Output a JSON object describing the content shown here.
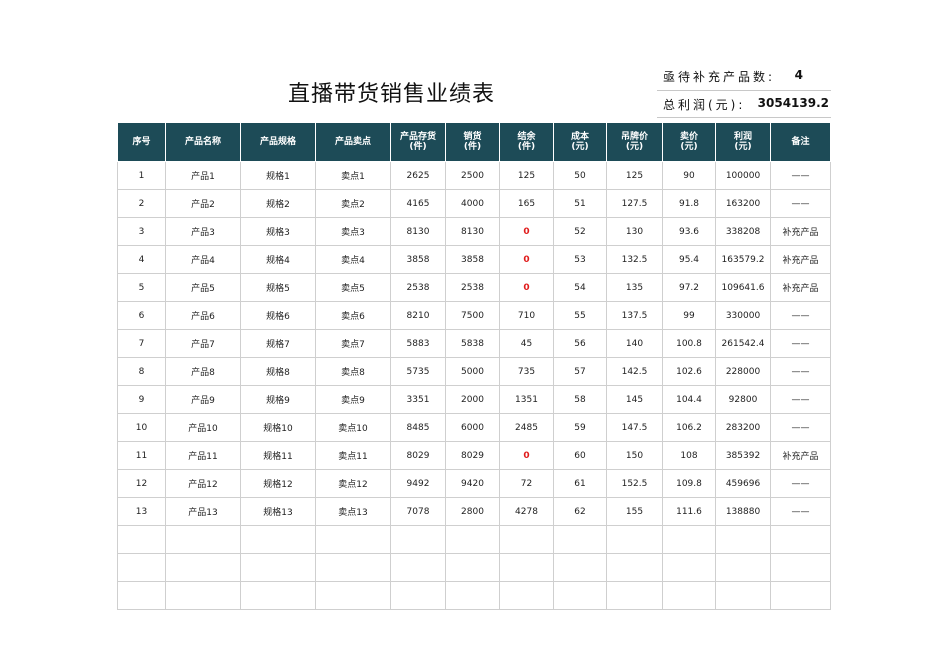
{
  "title": "直播带货销售业绩表",
  "summary": {
    "pending_label": "亟待补充产品数:",
    "pending_value": "4",
    "profit_label": "总利润(元):",
    "profit_value": "3054139.2"
  },
  "headers": [
    "序号",
    "产品名称",
    "产品规格",
    "产品卖点",
    "产品存货\n(件)",
    "销货\n(件)",
    "结余\n(件)",
    "成本\n(元)",
    "吊牌价\n(元)",
    "卖价\n(元)",
    "利润\n(元)",
    "备注"
  ],
  "rows": [
    [
      "1",
      "产品1",
      "规格1",
      "卖点1",
      "2625",
      "2500",
      "125",
      "50",
      "125",
      "90",
      "100000",
      "——"
    ],
    [
      "2",
      "产品2",
      "规格2",
      "卖点2",
      "4165",
      "4000",
      "165",
      "51",
      "127.5",
      "91.8",
      "163200",
      "——"
    ],
    [
      "3",
      "产品3",
      "规格3",
      "卖点3",
      "8130",
      "8130",
      "0",
      "52",
      "130",
      "93.6",
      "338208",
      "补充产品"
    ],
    [
      "4",
      "产品4",
      "规格4",
      "卖点4",
      "3858",
      "3858",
      "0",
      "53",
      "132.5",
      "95.4",
      "163579.2",
      "补充产品"
    ],
    [
      "5",
      "产品5",
      "规格5",
      "卖点5",
      "2538",
      "2538",
      "0",
      "54",
      "135",
      "97.2",
      "109641.6",
      "补充产品"
    ],
    [
      "6",
      "产品6",
      "规格6",
      "卖点6",
      "8210",
      "7500",
      "710",
      "55",
      "137.5",
      "99",
      "330000",
      "——"
    ],
    [
      "7",
      "产品7",
      "规格7",
      "卖点7",
      "5883",
      "5838",
      "45",
      "56",
      "140",
      "100.8",
      "261542.4",
      "——"
    ],
    [
      "8",
      "产品8",
      "规格8",
      "卖点8",
      "5735",
      "5000",
      "735",
      "57",
      "142.5",
      "102.6",
      "228000",
      "——"
    ],
    [
      "9",
      "产品9",
      "规格9",
      "卖点9",
      "3351",
      "2000",
      "1351",
      "58",
      "145",
      "104.4",
      "92800",
      "——"
    ],
    [
      "10",
      "产品10",
      "规格10",
      "卖点10",
      "8485",
      "6000",
      "2485",
      "59",
      "147.5",
      "106.2",
      "283200",
      "——"
    ],
    [
      "11",
      "产品11",
      "规格11",
      "卖点11",
      "8029",
      "8029",
      "0",
      "60",
      "150",
      "108",
      "385392",
      "补充产品"
    ],
    [
      "12",
      "产品12",
      "规格12",
      "卖点12",
      "9492",
      "9420",
      "72",
      "61",
      "152.5",
      "109.8",
      "459696",
      "——"
    ],
    [
      "13",
      "产品13",
      "规格13",
      "卖点13",
      "7078",
      "2800",
      "4278",
      "62",
      "155",
      "111.6",
      "138880",
      "——"
    ]
  ],
  "empty_rows": 3,
  "colors": {
    "header_bg": "#1d4b57",
    "zero_highlight": "#e01b1b"
  }
}
